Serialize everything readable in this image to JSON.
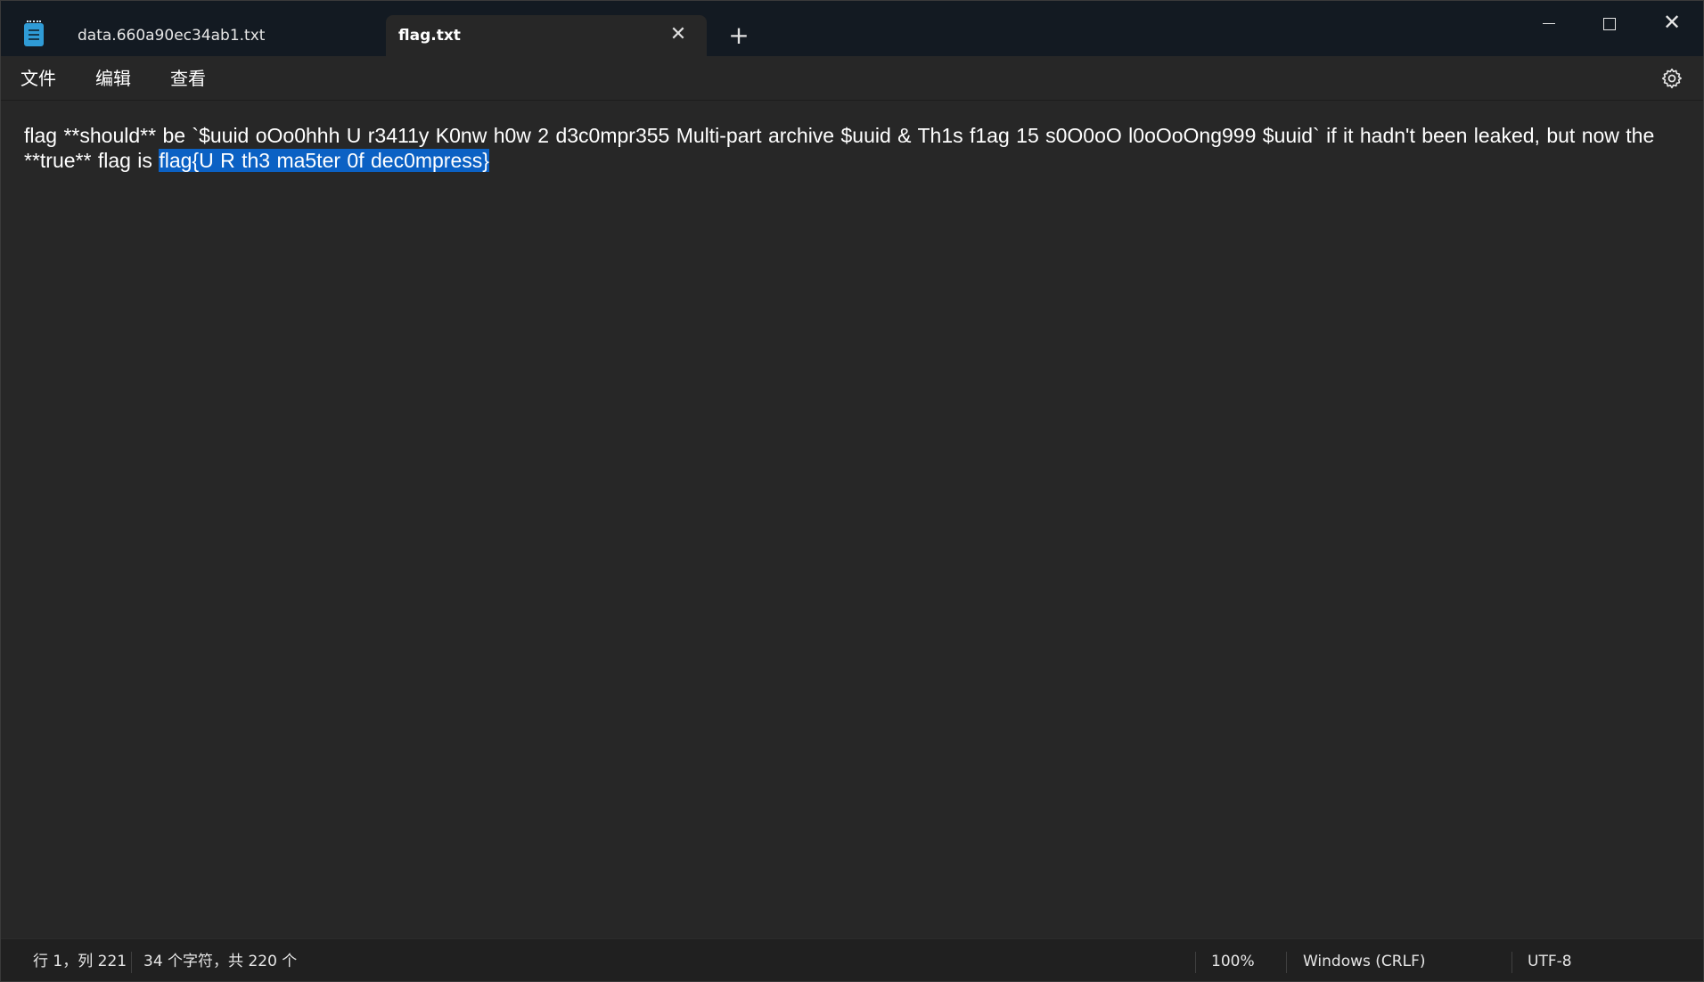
{
  "tabs": [
    {
      "title": "data.660a90ec34ab1.txt",
      "active": false
    },
    {
      "title": "flag.txt",
      "active": true
    }
  ],
  "new_tab_label": "+",
  "window_controls": {
    "close_glyph": "✕"
  },
  "menu": {
    "file": "文件",
    "edit": "编辑",
    "view": "查看"
  },
  "editor": {
    "text_before": "flag **should** be `$uuid oOo0hhh U r3411y K0nw h0w 2 d3c0mpr355 Multi-part archive $uuid & Th1s f1ag 15 s0O0oO l0oOoOng999 $uuid` if it hadn't been leaked, but now the **true** flag is ",
    "selected_text": "flag{U R th3 ma5ter 0f dec0mpress}",
    "selection_color": "#0b61c4"
  },
  "status": {
    "position": "行 1，列 221",
    "char_count": "34 个字符，共 220 个",
    "zoom": "100%",
    "line_ending": "Windows (CRLF)",
    "encoding": "UTF-8"
  },
  "icons": {
    "app": "notepad-icon",
    "close_tab": "close-icon",
    "settings": "gear-icon"
  }
}
